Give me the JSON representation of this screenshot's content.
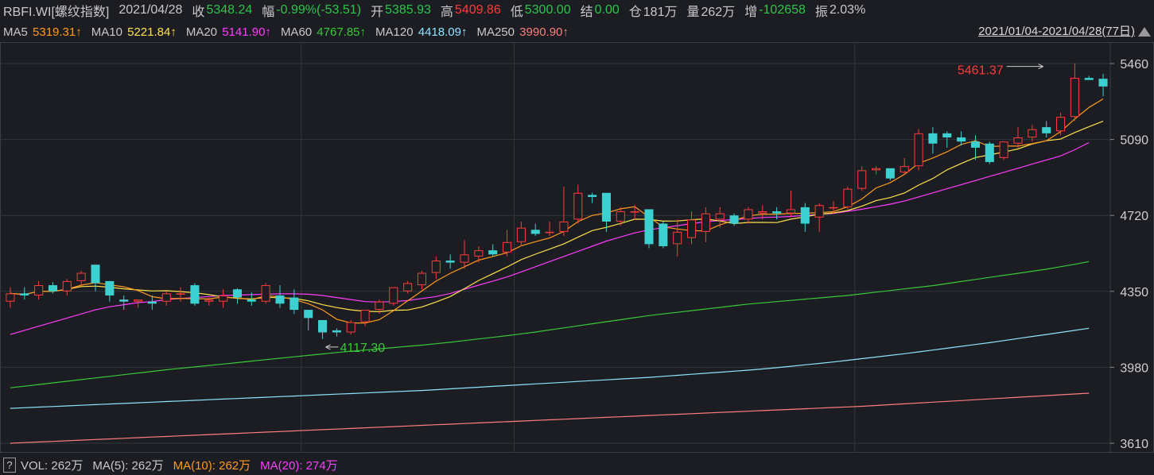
{
  "header": {
    "symbol": "RBFI.WI[螺纹指数]",
    "date": "2021/04/28",
    "close_label": "收",
    "close": "5348.24",
    "change_label": "幅",
    "change": "-0.99%(-53.51)",
    "open_label": "开",
    "open": "5385.93",
    "high_label": "高",
    "high": "5409.86",
    "low_label": "低",
    "low": "5300.00",
    "settle_label": "结",
    "settle": "0.00",
    "oi_label": "仓",
    "oi": "181万",
    "vol_label": "量",
    "vol": "262万",
    "oi_chg_label": "增",
    "oi_chg": "-102658",
    "amp_label": "振",
    "amp": "2.03%"
  },
  "ma_bar": {
    "ma5": "MA5",
    "ma5_val": "5319.31↑",
    "ma10": "MA10",
    "ma10_val": "5221.84↑",
    "ma20": "MA20",
    "ma20_val": "5141.90↑",
    "ma60": "MA60",
    "ma60_val": "4767.85↑",
    "ma120": "MA120",
    "ma120_val": "4418.09↑",
    "ma250": "MA250",
    "ma250_val": "3990.90↑",
    "range": "2021/01/04-2021/04/28(77日)"
  },
  "volume_bar": {
    "help": "?",
    "vol": "VOL: 262万",
    "ma5": "MA(5): 262万",
    "ma10": "MA(10): 262万",
    "ma20": "MA(20): 274万"
  },
  "colors": {
    "background": "#1b1d22",
    "up": "#ff3b3b",
    "down": "#3cd0d0",
    "ma5": "#ff9a1f",
    "ma10": "#ffe14a",
    "ma20": "#ff3cff",
    "ma60": "#38c838",
    "ma120": "#8fe3ff",
    "ma250": "#ff7e7e",
    "grid": "#33363c"
  },
  "chart_data": {
    "type": "candlestick",
    "y_axis_ticks": [
      "5460",
      "5090",
      "4720",
      "4350",
      "3980",
      "3610"
    ],
    "ylim": [
      3610,
      5460
    ],
    "x_range": "2021/01/04-2021/04/28",
    "count": 77,
    "annotations": [
      {
        "text": "5461.37",
        "kind": "high",
        "value": 5461.37,
        "index": 73
      },
      {
        "text": "4117.30",
        "kind": "low",
        "value": 4117.3,
        "index": 22
      }
    ],
    "ohlc": [
      [
        4300,
        4370,
        4270,
        4340
      ],
      [
        4340,
        4370,
        4310,
        4330
      ],
      [
        4330,
        4400,
        4310,
        4380
      ],
      [
        4380,
        4395,
        4340,
        4350
      ],
      [
        4350,
        4410,
        4330,
        4400
      ],
      [
        4400,
        4450,
        4380,
        4440
      ],
      [
        4480,
        4470,
        4350,
        4390
      ],
      [
        4400,
        4400,
        4300,
        4330
      ],
      [
        4310,
        4330,
        4260,
        4300
      ],
      [
        4300,
        4310,
        4270,
        4310
      ],
      [
        4300,
        4330,
        4260,
        4290
      ],
      [
        4300,
        4350,
        4280,
        4340
      ],
      [
        4340,
        4370,
        4300,
        4340
      ],
      [
        4380,
        4390,
        4280,
        4290
      ],
      [
        4300,
        4320,
        4280,
        4310
      ],
      [
        4300,
        4360,
        4270,
        4330
      ],
      [
        4360,
        4365,
        4290,
        4320
      ],
      [
        4310,
        4345,
        4280,
        4300
      ],
      [
        4300,
        4390,
        4290,
        4380
      ],
      [
        4330,
        4380,
        4270,
        4290
      ],
      [
        4320,
        4360,
        4240,
        4260
      ],
      [
        4260,
        4260,
        4160,
        4220
      ],
      [
        4210,
        4210,
        4117.3,
        4150
      ],
      [
        4160,
        4170,
        4130,
        4150
      ],
      [
        4150,
        4210,
        4140,
        4200
      ],
      [
        4200,
        4260,
        4180,
        4260
      ],
      [
        4260,
        4310,
        4240,
        4300
      ],
      [
        4290,
        4360,
        4280,
        4370
      ],
      [
        4350,
        4400,
        4340,
        4390
      ],
      [
        4380,
        4450,
        4360,
        4440
      ],
      [
        4440,
        4520,
        4410,
        4500
      ],
      [
        4500,
        4530,
        4460,
        4490
      ],
      [
        4490,
        4600,
        4460,
        4530
      ],
      [
        4520,
        4570,
        4490,
        4550
      ],
      [
        4550,
        4580,
        4520,
        4530
      ],
      [
        4540,
        4650,
        4520,
        4590
      ],
      [
        4590,
        4690,
        4570,
        4660
      ],
      [
        4650,
        4680,
        4620,
        4630
      ],
      [
        4640,
        4690,
        4620,
        4640
      ],
      [
        4640,
        4860,
        4620,
        4690
      ],
      [
        4700,
        4870,
        4680,
        4830
      ],
      [
        4820,
        4830,
        4780,
        4810
      ],
      [
        4830,
        4830,
        4640,
        4690
      ],
      [
        4690,
        4760,
        4670,
        4740
      ],
      [
        4740,
        4770,
        4700,
        4740
      ],
      [
        4750,
        4750,
        4560,
        4580
      ],
      [
        4680,
        4690,
        4560,
        4570
      ],
      [
        4580,
        4700,
        4520,
        4640
      ],
      [
        4610,
        4740,
        4580,
        4700
      ],
      [
        4640,
        4760,
        4590,
        4730
      ],
      [
        4700,
        4760,
        4660,
        4730
      ],
      [
        4720,
        4730,
        4670,
        4680
      ],
      [
        4700,
        4760,
        4680,
        4750
      ],
      [
        4730,
        4770,
        4700,
        4740
      ],
      [
        4740,
        4760,
        4700,
        4730
      ],
      [
        4730,
        4840,
        4710,
        4750
      ],
      [
        4760,
        4780,
        4640,
        4680
      ],
      [
        4710,
        4780,
        4640,
        4770
      ],
      [
        4760,
        4790,
        4730,
        4760
      ],
      [
        4760,
        4860,
        4750,
        4850
      ],
      [
        4850,
        4960,
        4840,
        4940
      ],
      [
        4940,
        4960,
        4920,
        4950
      ],
      [
        4950,
        4940,
        4890,
        4900
      ],
      [
        4930,
        5000,
        4920,
        4960
      ],
      [
        4960,
        5140,
        4940,
        5120
      ],
      [
        5120,
        5150,
        5020,
        5070
      ],
      [
        5120,
        5130,
        5050,
        5100
      ],
      [
        5100,
        5130,
        5060,
        5080
      ],
      [
        5080,
        5110,
        4990,
        5050
      ],
      [
        5070,
        5080,
        4970,
        4980
      ],
      [
        5000,
        5080,
        4990,
        5080
      ],
      [
        5070,
        5150,
        5050,
        5100
      ],
      [
        5100,
        5160,
        5080,
        5140
      ],
      [
        5150,
        5180,
        5100,
        5120
      ],
      [
        5130,
        5220,
        5110,
        5200
      ],
      [
        5200,
        5461.37,
        5180,
        5390
      ],
      [
        5390,
        5400,
        5380,
        5380
      ],
      [
        5385.93,
        5409.86,
        5300,
        5348.24
      ]
    ],
    "ma20": [
      4140,
      4160,
      4180,
      4200,
      4220,
      4240,
      4260,
      4275,
      4285,
      4295,
      4300,
      4310,
      4315,
      4320,
      4325,
      4330,
      4332,
      4334,
      4336,
      4338,
      4338,
      4336,
      4330,
      4320,
      4310,
      4300,
      4298,
      4300,
      4305,
      4315,
      4325,
      4340,
      4360,
      4380,
      4400,
      4420,
      4445,
      4470,
      4495,
      4520,
      4545,
      4570,
      4595,
      4615,
      4635,
      4650,
      4660,
      4670,
      4680,
      4690,
      4695,
      4700,
      4705,
      4710,
      4712,
      4715,
      4720,
      4725,
      4730,
      4740,
      4750,
      4762,
      4775,
      4790,
      4810,
      4830,
      4850,
      4870,
      4890,
      4910,
      4930,
      4950,
      4970,
      4990,
      5010,
      5040,
      5075
    ],
    "ma60": [
      3880,
      3888,
      3896,
      3904,
      3912,
      3920,
      3928,
      3936,
      3944,
      3952,
      3960,
      3968,
      3975,
      3982,
      3989,
      3996,
      4003,
      4010,
      4017,
      4024,
      4031,
      4038,
      4045,
      4052,
      4058,
      4064,
      4070,
      4076,
      4082,
      4088,
      4095,
      4102,
      4110,
      4118,
      4126,
      4134,
      4143,
      4152,
      4162,
      4172,
      4182,
      4192,
      4202,
      4212,
      4222,
      4232,
      4240,
      4248,
      4256,
      4264,
      4272,
      4280,
      4288,
      4294,
      4300,
      4306,
      4312,
      4318,
      4324,
      4330,
      4338,
      4346,
      4354,
      4362,
      4370,
      4378,
      4388,
      4398,
      4408,
      4418,
      4428,
      4438,
      4448,
      4458,
      4470,
      4482,
      4495
    ],
    "ma120": [
      3780,
      3783,
      3786,
      3789,
      3792,
      3795,
      3798,
      3801,
      3804,
      3807,
      3810,
      3813,
      3816,
      3819,
      3822,
      3825,
      3828,
      3831,
      3834,
      3837,
      3840,
      3843,
      3846,
      3849,
      3852,
      3855,
      3858,
      3861,
      3864,
      3867,
      3871,
      3875,
      3879,
      3883,
      3887,
      3891,
      3895,
      3899,
      3903,
      3907,
      3911,
      3915,
      3919,
      3923,
      3927,
      3931,
      3936,
      3941,
      3946,
      3951,
      3956,
      3961,
      3966,
      3972,
      3978,
      3985,
      3992,
      3999,
      4006,
      4014,
      4022,
      4030,
      4038,
      4046,
      4055,
      4064,
      4073,
      4082,
      4091,
      4100,
      4110,
      4120,
      4130,
      4140,
      4150,
      4160,
      4170
    ],
    "ma250": [
      3610,
      3613,
      3616,
      3619,
      3622,
      3625,
      3628,
      3631,
      3634,
      3637,
      3640,
      3643,
      3646,
      3649,
      3652,
      3655,
      3658,
      3661,
      3664,
      3667,
      3670,
      3673,
      3676,
      3679,
      3682,
      3685,
      3688,
      3691,
      3694,
      3697,
      3700,
      3703,
      3706,
      3709,
      3712,
      3715,
      3718,
      3721,
      3724,
      3727,
      3730,
      3733,
      3736,
      3739,
      3742,
      3745,
      3748,
      3751,
      3754,
      3757,
      3760,
      3763,
      3766,
      3769,
      3772,
      3775,
      3778,
      3781,
      3784,
      3787,
      3790,
      3794,
      3798,
      3802,
      3806,
      3810,
      3814,
      3818,
      3822,
      3826,
      3830,
      3834,
      3838,
      3842,
      3846,
      3850,
      3854
    ]
  }
}
